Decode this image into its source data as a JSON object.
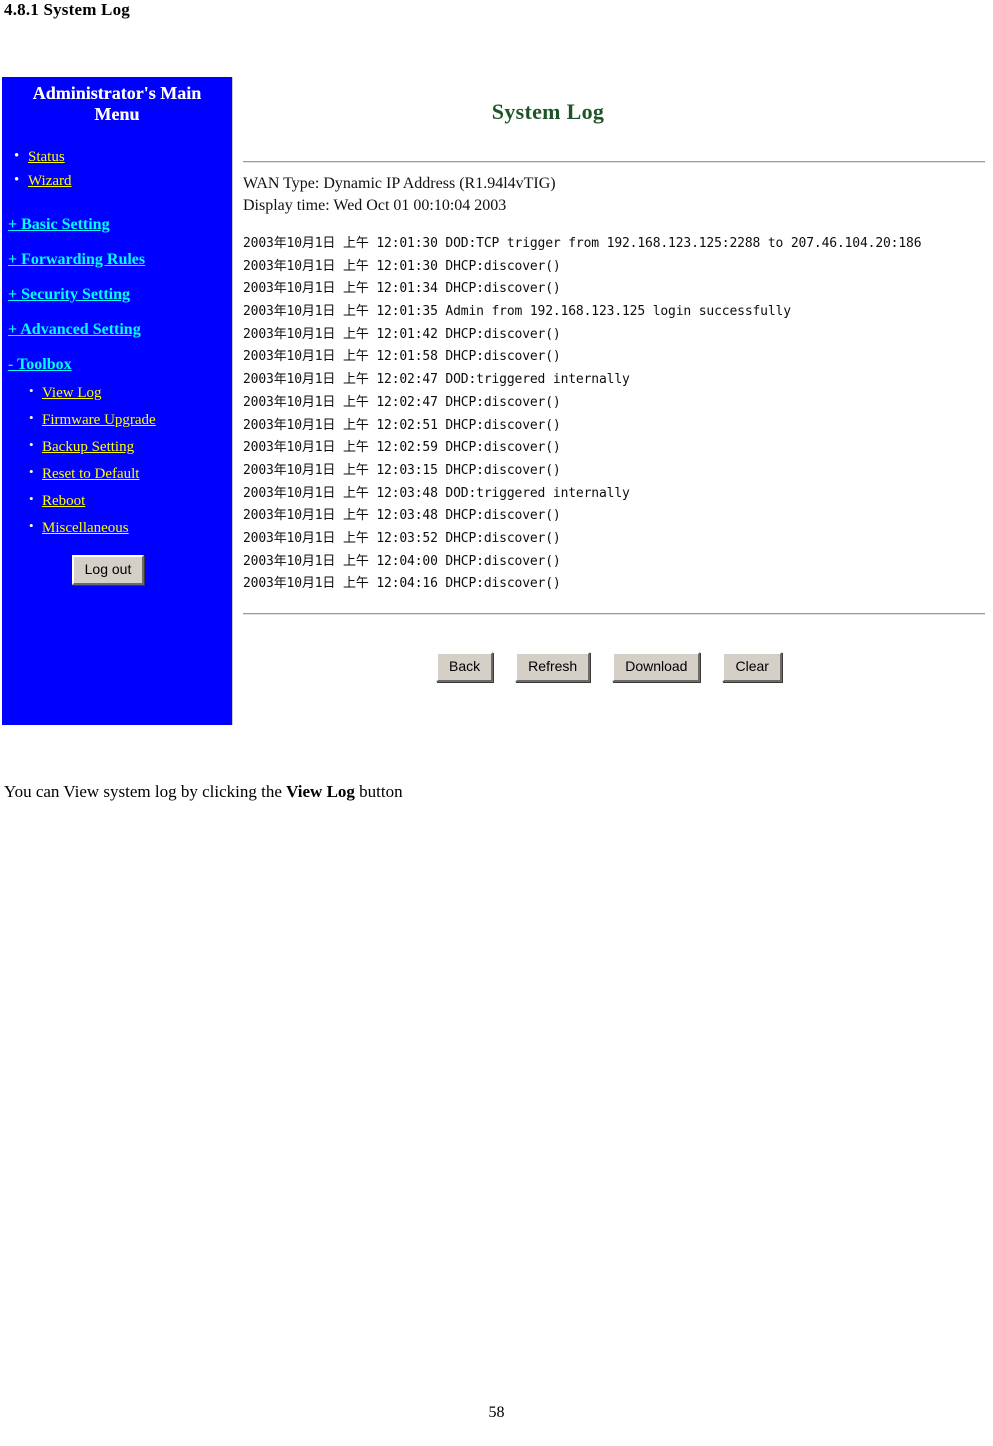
{
  "document": {
    "section_heading": "4.8.1 System Log",
    "caption_before": "You can View system log by clicking the ",
    "caption_bold": "View Log",
    "caption_after": " button",
    "page_number": "58"
  },
  "colors": {
    "sidebar_background": "#0000ff",
    "sidebar_link_yellow": "#ffff00",
    "sidebar_link_cyan": "#00ffff",
    "title_green": "#1d5526",
    "button_face": "#d4d0c8"
  },
  "sidebar": {
    "title": "Administrator's Main Menu",
    "bullets": [
      {
        "label": "Status"
      },
      {
        "label": "Wizard"
      }
    ],
    "sections": [
      {
        "label": "+ Basic Setting"
      },
      {
        "label": "+ Forwarding Rules"
      },
      {
        "label": "+ Security Setting"
      },
      {
        "label": "+ Advanced Setting"
      }
    ],
    "toolbox": {
      "label": "- Toolbox",
      "items": [
        {
          "label": "View Log"
        },
        {
          "label": "Firmware Upgrade"
        },
        {
          "label": "Backup Setting"
        },
        {
          "label": "Reset to Default"
        },
        {
          "label": "Reboot"
        },
        {
          "label": "Miscellaneous"
        }
      ]
    },
    "logout_label": "Log out"
  },
  "main": {
    "title": "System Log",
    "wan_type": "WAN Type: Dynamic IP Address (R1.94l4vTIG)",
    "display_time": "Display time: Wed Oct 01 00:10:04 2003",
    "log_lines": [
      "2003年10月1日 上午 12:01:30 DOD:TCP trigger from 192.168.123.125:2288 to 207.46.104.20:186",
      "2003年10月1日 上午 12:01:30 DHCP:discover()",
      "2003年10月1日 上午 12:01:34 DHCP:discover()",
      "2003年10月1日 上午 12:01:35 Admin from 192.168.123.125 login successfully",
      "2003年10月1日 上午 12:01:42 DHCP:discover()",
      "2003年10月1日 上午 12:01:58 DHCP:discover()",
      "2003年10月1日 上午 12:02:47 DOD:triggered internally",
      "2003年10月1日 上午 12:02:47 DHCP:discover()",
      "2003年10月1日 上午 12:02:51 DHCP:discover()",
      "2003年10月1日 上午 12:02:59 DHCP:discover()",
      "2003年10月1日 上午 12:03:15 DHCP:discover()",
      "2003年10月1日 上午 12:03:48 DOD:triggered internally",
      "2003年10月1日 上午 12:03:48 DHCP:discover()",
      "2003年10月1日 上午 12:03:52 DHCP:discover()",
      "2003年10月1日 上午 12:04:00 DHCP:discover()",
      "2003年10月1日 上午 12:04:16 DHCP:discover()"
    ],
    "buttons": [
      {
        "label": "Back"
      },
      {
        "label": "Refresh"
      },
      {
        "label": "Download"
      },
      {
        "label": "Clear"
      }
    ]
  }
}
